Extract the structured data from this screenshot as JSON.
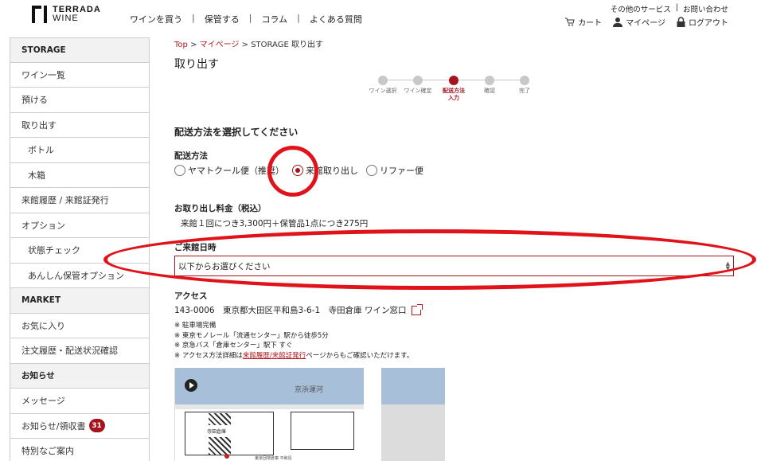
{
  "header": {
    "logo_line1": "TERRADA",
    "logo_line2": "WINE",
    "nav": [
      "ワインを買う",
      "保管する",
      "コラム",
      "よくある質問"
    ],
    "util_top": [
      "その他のサービス",
      "お問い合わせ"
    ],
    "cart": "カート",
    "mypage": "マイページ",
    "logout": "ログアウト"
  },
  "sidebar": {
    "items": [
      {
        "label": "STORAGE",
        "type": "head"
      },
      {
        "label": "ワイン一覧",
        "type": "item"
      },
      {
        "label": "預ける",
        "type": "item"
      },
      {
        "label": "取り出す",
        "type": "item"
      },
      {
        "label": "ボトル",
        "type": "sub"
      },
      {
        "label": "木箱",
        "type": "sub"
      },
      {
        "label": "来館履歴 / 来館証発行",
        "type": "item"
      },
      {
        "label": "オプション",
        "type": "item"
      },
      {
        "label": "状態チェック",
        "type": "sub"
      },
      {
        "label": "あんしん保管オプション",
        "type": "sub"
      },
      {
        "label": "MARKET",
        "type": "head"
      },
      {
        "label": "お気に入り",
        "type": "item"
      },
      {
        "label": "注文履歴・配送状況確認",
        "type": "item"
      },
      {
        "label": "お知らせ",
        "type": "head"
      },
      {
        "label": "メッセージ",
        "type": "item"
      },
      {
        "label": "お知らせ/領収書",
        "type": "item",
        "badge": "31"
      },
      {
        "label": "特別なご案内",
        "type": "item"
      }
    ]
  },
  "breadcrumb": {
    "top": "Top",
    "mypage": "マイページ",
    "current": "STORAGE 取り出す"
  },
  "page_title": "取り出す",
  "steps": [
    {
      "label": "ワイン選択",
      "active": false
    },
    {
      "label": "ワイン確定",
      "active": false
    },
    {
      "label": "配送方法\n入力",
      "active": true
    },
    {
      "label": "確認",
      "active": false
    },
    {
      "label": "完了",
      "active": false
    }
  ],
  "form": {
    "section_title": "配送方法を選択してください",
    "method_label": "配送方法",
    "methods": [
      {
        "label": "ヤマトクール便（推奨）",
        "checked": false
      },
      {
        "label": "来館取り出し",
        "checked": true
      },
      {
        "label": "リファー便",
        "checked": false
      }
    ],
    "fee_label": "お取り出し料金（税込）",
    "fee_text": "来館１回につき3,300円＋保管品1点につき275円",
    "date_label": "ご来館日時",
    "date_placeholder": "以下からお選びください",
    "access_label": "アクセス",
    "address": "143-0006　東京都大田区平和島3-6-1　寺田倉庫 ワイン窓口",
    "notes": [
      "※ 駐車場完備",
      "※ 東京モノレール「流通センター」駅から徒歩5分",
      "※ 京急バス「倉庫センター」駅下 すぐ"
    ],
    "note_link_prefix": "※ アクセス方法詳細は",
    "note_link": "来館履歴/来館証発行",
    "note_link_suffix": "ページからもご確認いただけます。"
  },
  "map": {
    "water_label": "京浜運河",
    "building_label": "寺田倉庫",
    "bottom_label": "東京団地倉庫 平和島"
  },
  "colors": {
    "accent": "#a5141d",
    "annotation": "#e0121a"
  }
}
